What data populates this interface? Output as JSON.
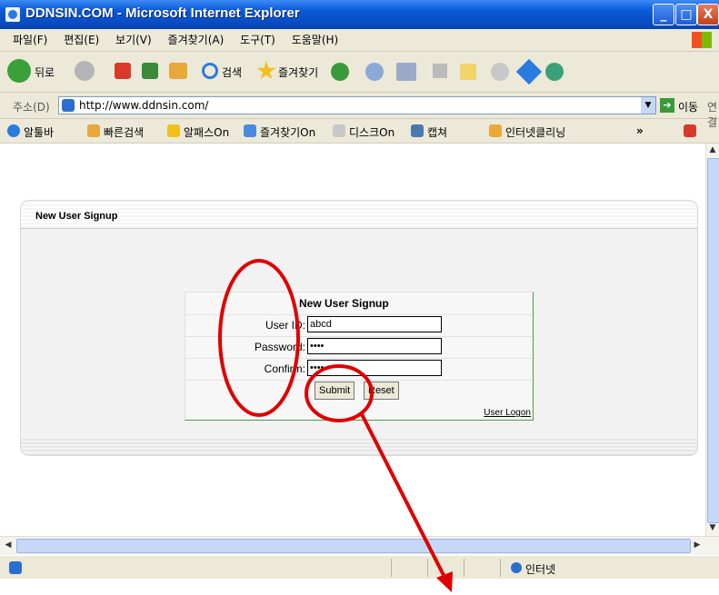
{
  "window": {
    "title": "DDNSIN.COM - Microsoft Internet Explorer",
    "buttons": [
      "_",
      "□",
      "X"
    ]
  },
  "menu": [
    "파일(F)",
    "편집(E)",
    "보기(V)",
    "즐겨찾기(A)",
    "도구(T)",
    "도움말(H)"
  ],
  "toolbar": {
    "back": "뒤로",
    "search": "검색",
    "favorites": "즐겨찾기"
  },
  "address": {
    "label": "주소(D)",
    "url": "http://www.ddnsin.com/",
    "go": "이동",
    "links": "연결"
  },
  "linksbar": [
    "알툴바",
    "빠른검색",
    "알패스On",
    "즐겨찾기On",
    "디스크On",
    "캡쳐",
    "인터넷클리닝"
  ],
  "page": {
    "panel_title": "New User Signup",
    "form_title": "New User Signup",
    "user_id_label": "User ID:",
    "user_id_value": "abcd",
    "password_label": "Password:",
    "password_value": "••••",
    "confirm_label": "Confirm:",
    "confirm_value": "••••",
    "submit": "Submit",
    "reset": "Reset",
    "user_logon": "User Logon"
  },
  "status": {
    "zone": "인터넷"
  },
  "annotations": {
    "color": "#e00000"
  }
}
